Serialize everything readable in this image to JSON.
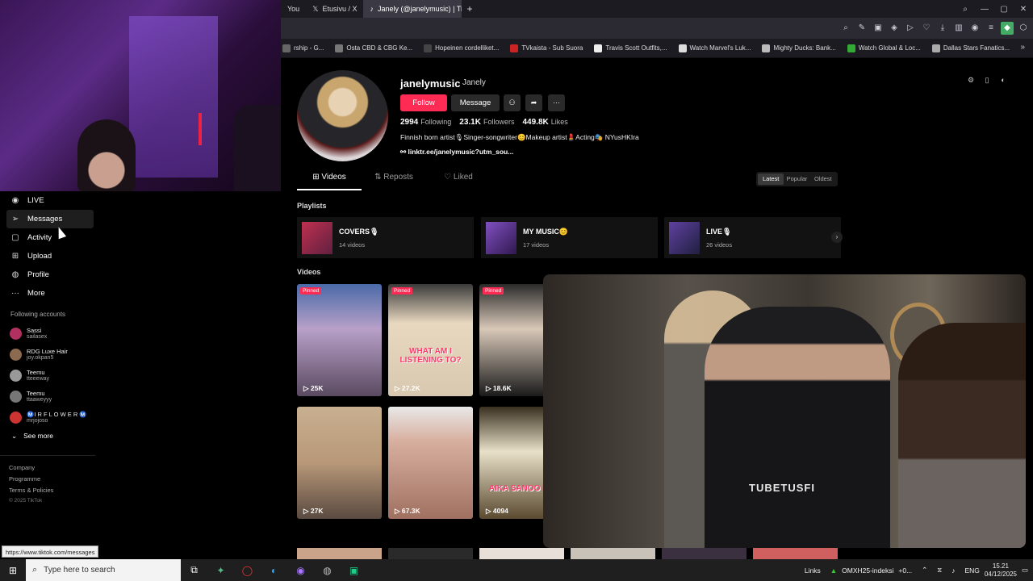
{
  "browser": {
    "tabs": [
      {
        "label": "You"
      },
      {
        "label": "Etusivu / X"
      },
      {
        "label": "Janely (@janelymusic) | Ti"
      }
    ],
    "bookmarks": [
      {
        "label": "rship - G...",
        "color": "#666"
      },
      {
        "label": "Osta CBD & CBG Ke...",
        "color": "#777"
      },
      {
        "label": "Hopeinen cordelliket...",
        "color": "#444"
      },
      {
        "label": "TVkaista - Sub Suora",
        "color": "#c22"
      },
      {
        "label": "Travis Scott Outfits,...",
        "color": "#eee"
      },
      {
        "label": "Watch Marvel's Luk...",
        "color": "#ddd"
      },
      {
        "label": "Mighty Ducks: Bank...",
        "color": "#bbb"
      },
      {
        "label": "Watch Global & Loc...",
        "color": "#3a3"
      },
      {
        "label": "Dallas Stars Fanatics...",
        "color": "#aaa"
      }
    ],
    "status_url": "https://www.tiktok.com/messages"
  },
  "leftnav": {
    "items": [
      {
        "label": "LIVE",
        "icon": "live-icon"
      },
      {
        "label": "Messages",
        "icon": "messages-icon"
      },
      {
        "label": "Activity",
        "icon": "activity-icon"
      },
      {
        "label": "Upload",
        "icon": "upload-icon"
      },
      {
        "label": "Profile",
        "icon": "profile-icon"
      },
      {
        "label": "More",
        "icon": "more-icon"
      }
    ],
    "following_title": "Following accounts",
    "accounts": [
      {
        "name": "Sassi",
        "handle": "sailasex",
        "color": "#b03060"
      },
      {
        "name": "RDG Luxe Hair",
        "handle": "joy.okpan5",
        "color": "#8b6a50"
      },
      {
        "name": "Teemu",
        "handle": "tteeeway",
        "color": "#999"
      },
      {
        "name": "Teemu",
        "handle": "ttaaweyyy",
        "color": "#777"
      },
      {
        "name": "Ⓜ️I R F L O W E R Ⓜ️",
        "handle": "mrjojoso",
        "color": "#c33"
      }
    ],
    "see_more": "See more",
    "footer": {
      "company": "Company",
      "programme": "Programme",
      "terms": "Terms & Policies",
      "copyright": "© 2025 TikTok"
    }
  },
  "profile": {
    "username": "janelymusic",
    "display_name": "Janely",
    "follow_label": "Follow",
    "message_label": "Message",
    "following_count": "2994",
    "following_label": "Following",
    "followers_count": "23.1K",
    "followers_label": "Followers",
    "likes_count": "449.8K",
    "likes_label": "Likes",
    "bio": "Finnish born artist🎙Singer-songwriter😊Makeup artist💄Acting🎭 NYusHKIra",
    "link": "linktr.ee/janelymusic?utm_sou...",
    "tabs": [
      "Videos",
      "Reposts",
      "Liked"
    ],
    "sort": [
      "Latest",
      "Popular",
      "Oldest"
    ]
  },
  "playlists": {
    "title": "Playlists",
    "items": [
      {
        "name": "COVERS🎙",
        "count": "14 videos"
      },
      {
        "name": "MY MUSIC😊",
        "count": "17 videos"
      },
      {
        "name": "LIVE🎙",
        "count": "26 videos"
      }
    ]
  },
  "videos": {
    "title": "Videos",
    "pinned_label": "Pinned",
    "items": [
      {
        "views": "25K",
        "pinned": true,
        "caption": ""
      },
      {
        "views": "27.2K",
        "pinned": true,
        "caption": "WHAT AM I LISTENING TO?"
      },
      {
        "views": "18.6K",
        "pinned": true,
        "caption": ""
      },
      {
        "views": "27K",
        "pinned": false,
        "caption": ""
      },
      {
        "views": "67.3K",
        "pinned": false,
        "caption": ""
      },
      {
        "views": "4094",
        "pinned": false,
        "caption": "AIKA SANOO BO"
      }
    ]
  },
  "overlay_video": {
    "watermark": "TUBETUSFI"
  },
  "taskbar": {
    "search_placeholder": "Type here to search",
    "links": "Links",
    "ticker": "OMXH25-indeksi",
    "ticker_change": "+0...",
    "lang": "ENG",
    "time": "15.21",
    "date": "04/12/2025"
  }
}
